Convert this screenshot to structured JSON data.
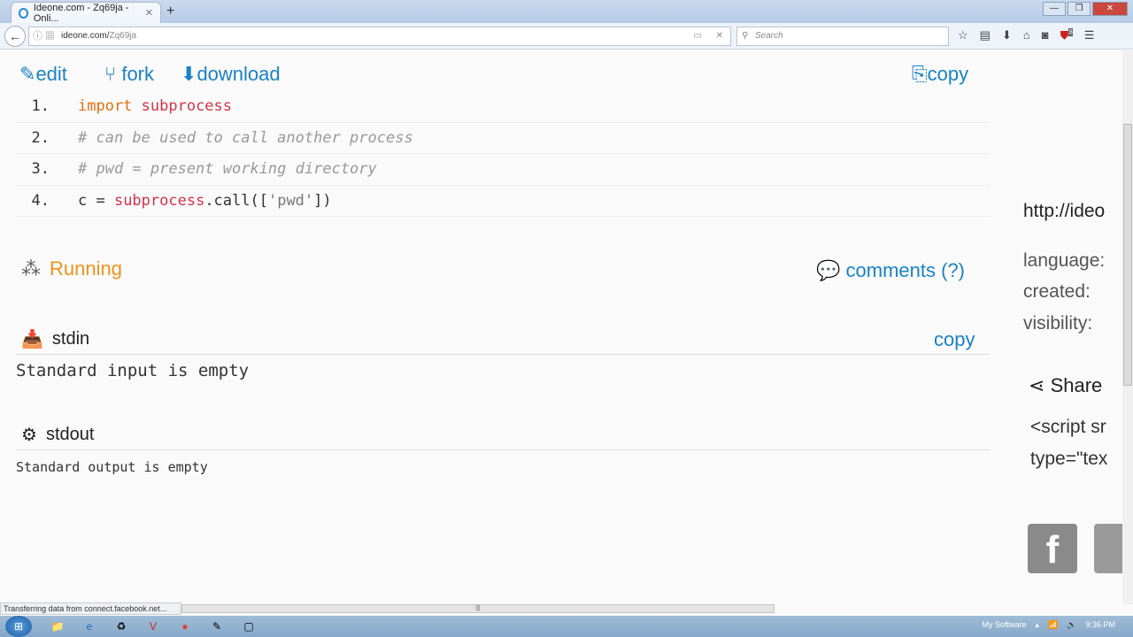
{
  "browser": {
    "tab_title": "Ideone.com - Zq69ja - Onli...",
    "url_host": "ideone.com/",
    "url_path": "Zq69ja",
    "search_placeholder": "Search",
    "badge_count": "8",
    "status": "Transferring data from connect.facebook.net..."
  },
  "toolbar": {
    "edit": "edit",
    "fork": "fork",
    "download": "download",
    "copy": "copy"
  },
  "code": [
    {
      "num": "1.",
      "tokens": [
        {
          "t": "import",
          "c": "kw"
        },
        {
          "t": " subprocess",
          "c": "md"
        }
      ]
    },
    {
      "num": "2.",
      "tokens": [
        {
          "t": "# can be used to call another process",
          "c": "cm"
        }
      ]
    },
    {
      "num": "3.",
      "tokens": [
        {
          "t": "# pwd = present working directory",
          "c": "cm"
        }
      ]
    },
    {
      "num": "4.",
      "tokens": [
        {
          "t": "c = ",
          "c": "op"
        },
        {
          "t": "subprocess",
          "c": "md"
        },
        {
          "t": ".call([",
          "c": "op"
        },
        {
          "t": "'pwd'",
          "c": "st"
        },
        {
          "t": "])",
          "c": "op"
        }
      ]
    }
  ],
  "run": {
    "status": "Running",
    "comments": "comments (?)"
  },
  "stdin": {
    "title": "stdin",
    "copy": "copy",
    "content": "Standard input is empty"
  },
  "stdout": {
    "title": "stdout",
    "content": "Standard output is empty"
  },
  "sidebar": {
    "url": "http://ideo",
    "language": "language:",
    "created": "created:",
    "visibility": "visibility:",
    "share": "Share",
    "embed1": "<script sr",
    "embed2": "type=\"tex"
  },
  "taskbar": {
    "tray_label": "My Software",
    "time": "9:36 PM"
  },
  "colors": {
    "link": "#1a82c4",
    "running": "#f0931a"
  }
}
